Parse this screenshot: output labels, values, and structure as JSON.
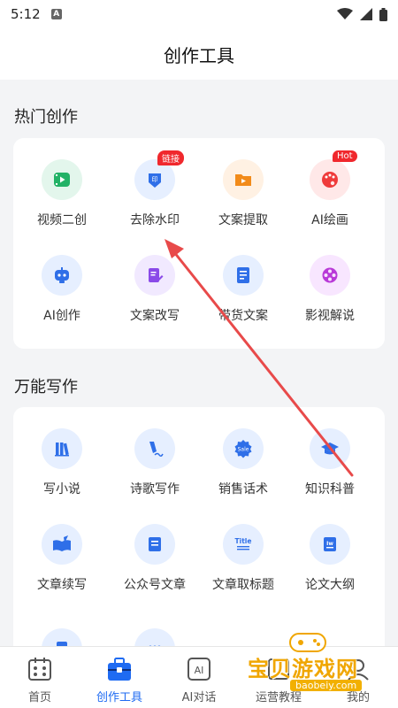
{
  "status": {
    "time": "5:12"
  },
  "header": {
    "title": "创作工具"
  },
  "hot": {
    "title": "热门创作",
    "items": [
      {
        "label": "视频二创",
        "icon": "video-play-icon",
        "bg": "#e3f6ec",
        "fg": "#22b266",
        "badge": ""
      },
      {
        "label": "去除水印",
        "icon": "stamp-icon",
        "bg": "#e6efff",
        "fg": "#2f6fe8",
        "badge": "链接"
      },
      {
        "label": "文案提取",
        "icon": "folder-play-icon",
        "bg": "#fff1e3",
        "fg": "#f28b1a",
        "badge": ""
      },
      {
        "label": "AI绘画",
        "icon": "palette-icon",
        "bg": "#ffe8e8",
        "fg": "#ef3b3b",
        "badge": "Hot"
      },
      {
        "label": "AI创作",
        "icon": "robot-icon",
        "bg": "#e6efff",
        "fg": "#2f6fe8",
        "badge": ""
      },
      {
        "label": "文案改写",
        "icon": "edit-doc-icon",
        "bg": "#f1e9ff",
        "fg": "#8a4ae8",
        "badge": ""
      },
      {
        "label": "带货文案",
        "icon": "document-icon",
        "bg": "#e6efff",
        "fg": "#2f6fe8",
        "badge": ""
      },
      {
        "label": "影视解说",
        "icon": "film-reel-icon",
        "bg": "#f8e6ff",
        "fg": "#b93ad8",
        "badge": ""
      }
    ]
  },
  "universal": {
    "title": "万能写作",
    "items": [
      {
        "label": "写小说",
        "icon": "books-icon"
      },
      {
        "label": "诗歌写作",
        "icon": "pen-icon"
      },
      {
        "label": "销售话术",
        "icon": "sale-badge-icon",
        "icon_text": "Sale"
      },
      {
        "label": "知识科普",
        "icon": "graduation-cap-icon"
      },
      {
        "label": "文章续写",
        "icon": "open-book-icon"
      },
      {
        "label": "公众号文章",
        "icon": "article-icon"
      },
      {
        "label": "文章取标题",
        "icon": "title-icon",
        "icon_text": "Title"
      },
      {
        "label": "论文大纲",
        "icon": "paper-icon",
        "icon_text": "Iw"
      }
    ]
  },
  "nav": [
    {
      "label": "首页",
      "icon": "home-grid-icon",
      "active": false
    },
    {
      "label": "创作工具",
      "icon": "toolbox-icon",
      "active": true
    },
    {
      "label": "AI对话",
      "icon": "ai-chat-icon",
      "active": false
    },
    {
      "label": "运营教程",
      "icon": "tutorial-icon",
      "active": false
    },
    {
      "label": "我的",
      "icon": "profile-icon",
      "active": false
    }
  ],
  "watermark": {
    "text": "宝贝游戏网",
    "url": "baobeiy.com"
  },
  "colors": {
    "accent": "#1f6bf2",
    "badge": "#f0282d",
    "arrow": "#e84a4a"
  }
}
